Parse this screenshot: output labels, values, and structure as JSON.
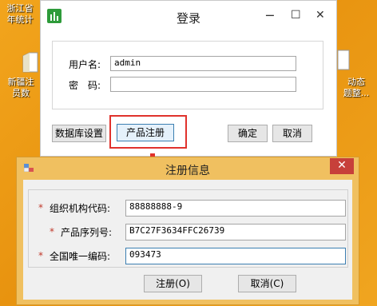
{
  "desktop": {
    "icon1_label": "浙江省\n年统计",
    "icon2_label": "新疆注\n员数",
    "icon3_label": "动态\n题整..."
  },
  "login": {
    "title": "登录",
    "minimize_glyph": "─",
    "maximize_glyph": "☐",
    "close_glyph": "✕",
    "username_label": "用户名:",
    "username_value": "admin",
    "password_label": "密　码:",
    "password_value": "",
    "db_settings_label": "数据库设置",
    "register_product_label": "产品注册",
    "ok_label": "确定",
    "cancel_label": "取消"
  },
  "register": {
    "title": "注册信息",
    "close_glyph": "✕",
    "org_code_label": "组织机构代码:",
    "org_code_value": "88888888-9",
    "serial_label": "产品序列号:",
    "serial_value": "B7C27F3634FFC26739",
    "unique_code_label": "全国唯一编码:",
    "unique_code_value": "093473",
    "required_mark": "*",
    "register_button_label": "注册(O)",
    "cancel_button_label": "取消(C)"
  },
  "colors": {
    "accent_highlight": "#e0322c",
    "close_button": "#c7403a",
    "desktop_bg": "#f0a520"
  }
}
